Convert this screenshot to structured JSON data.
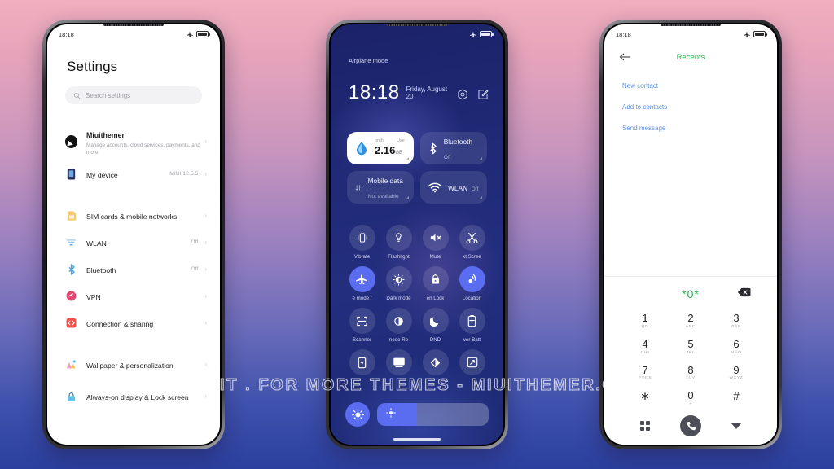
{
  "watermark": "VISIT . FOR  MORE  THEMES  -  MIUITHEMER.COM",
  "colors": {
    "accent_blue": "#5a6cf0",
    "accent_green": "#27b14d",
    "link_blue": "#5b8fe0",
    "cc_background": "#232e7e"
  },
  "phone1": {
    "statusbar": {
      "time": "18:18",
      "airplane_icon": "airplane-icon",
      "battery_icon": "battery-icon"
    },
    "title": "Settings",
    "search": {
      "placeholder": "Search settings",
      "icon": "search-icon"
    },
    "items": [
      {
        "label": "Miuithemer",
        "sub": "Manage accounts, cloud services, payments, and more",
        "value": "",
        "icon": "account-avatar"
      },
      {
        "label": "My device",
        "sub": "",
        "value": "MIUI 12.5.5",
        "icon": "phone-icon"
      },
      {
        "label": "SIM cards & mobile networks",
        "sub": "",
        "value": "",
        "icon": "sim-card-icon"
      },
      {
        "label": "WLAN",
        "sub": "",
        "value": "Off",
        "icon": "wifi-icon"
      },
      {
        "label": "Bluetooth",
        "sub": "",
        "value": "Off",
        "icon": "bluetooth-icon"
      },
      {
        "label": "VPN",
        "sub": "",
        "value": "",
        "icon": "vpn-icon"
      },
      {
        "label": "Connection & sharing",
        "sub": "",
        "value": "",
        "icon": "connection-sharing-icon"
      },
      {
        "label": "Wallpaper & personalization",
        "sub": "",
        "value": "",
        "icon": "wallpaper-icon"
      },
      {
        "label": "Always-on display & Lock screen",
        "sub": "",
        "value": "",
        "icon": "lock-screen-icon"
      }
    ],
    "chevron": "›"
  },
  "phone2": {
    "statusbar": {
      "airplane_label": "Airplane mode",
      "airplane_icon": "airplane-icon",
      "battery_icon": "battery-icon"
    },
    "clock": {
      "time": "18:18",
      "date": "Friday, August 20"
    },
    "header_actions": [
      {
        "name": "settings-gear-icon"
      },
      {
        "name": "edit-icon"
      }
    ],
    "big_tiles": [
      {
        "name": "Data usage",
        "state": "",
        "icon": "data-drop-icon",
        "active": true,
        "head_left": "onth",
        "head_right": "Use",
        "amount": "2.16",
        "unit": "GB"
      },
      {
        "name": "Bluetooth",
        "state": "Off",
        "icon": "bluetooth-icon",
        "active": false
      },
      {
        "name": "Mobile data",
        "state": "Not available",
        "icon": "mobile-data-icon",
        "active": false
      },
      {
        "name": "WLAN",
        "state": "Off",
        "icon": "wifi-icon",
        "active": false
      }
    ],
    "toggles": [
      {
        "label": "Vibrate",
        "icon": "vibrate-icon",
        "on": false
      },
      {
        "label": "Flashlight",
        "icon": "flashlight-icon",
        "on": false
      },
      {
        "label": "Mute",
        "icon": "mute-icon",
        "on": false
      },
      {
        "label": "xt   Scree",
        "icon": "screenshot-icon",
        "on": false
      },
      {
        "label": "e mode   /",
        "icon": "airplane-icon",
        "on": true
      },
      {
        "label": "Dark mode",
        "icon": "dark-mode-icon",
        "on": false
      },
      {
        "label": "en   Lock",
        "icon": "lock-icon",
        "on": false
      },
      {
        "label": "Location",
        "icon": "location-icon",
        "on": true
      },
      {
        "label": "Scanner",
        "icon": "scanner-icon",
        "on": false
      },
      {
        "label": "node   Re",
        "icon": "reading-mode-icon",
        "on": false
      },
      {
        "label": "DND",
        "icon": "dnd-moon-icon",
        "on": false
      },
      {
        "label": "ver   Batt",
        "icon": "battery-saver-icon",
        "on": false
      },
      {
        "label": "",
        "icon": "power-icon",
        "on": false
      },
      {
        "label": "",
        "icon": "cast-icon",
        "on": false
      },
      {
        "label": "",
        "icon": "nfc-icon",
        "on": false
      },
      {
        "label": "",
        "icon": "rotate-icon",
        "on": false
      }
    ],
    "brightness": {
      "button_icon": "sun-icon",
      "slider_icon": "brightness-icon",
      "fill_percent": 36
    }
  },
  "phone3": {
    "statusbar": {
      "time": "18:18",
      "airplane_icon": "airplane-icon",
      "battery_icon": "battery-icon"
    },
    "back_icon": "back-arrow-icon",
    "title": "Recents",
    "links": [
      "New contact",
      "Add to contacts",
      "Send message"
    ],
    "dialed_number": "*0*",
    "backspace_icon": "backspace-icon",
    "keys": [
      {
        "num": "1",
        "sub": "QD"
      },
      {
        "num": "2",
        "sub": "ABC"
      },
      {
        "num": "3",
        "sub": "DEF"
      },
      {
        "num": "4",
        "sub": "GHI"
      },
      {
        "num": "5",
        "sub": "JKL"
      },
      {
        "num": "6",
        "sub": "MNO"
      },
      {
        "num": "7",
        "sub": "PQRS"
      },
      {
        "num": "8",
        "sub": "TUV"
      },
      {
        "num": "9",
        "sub": "WXYZ"
      },
      {
        "num": "∗",
        "sub": ""
      },
      {
        "num": "0",
        "sub": "+"
      },
      {
        "num": "#",
        "sub": ""
      }
    ],
    "bottom_actions": [
      {
        "name": "keypad-grid-icon"
      },
      {
        "name": "call-button"
      },
      {
        "name": "hide-keypad-icon"
      }
    ]
  }
}
